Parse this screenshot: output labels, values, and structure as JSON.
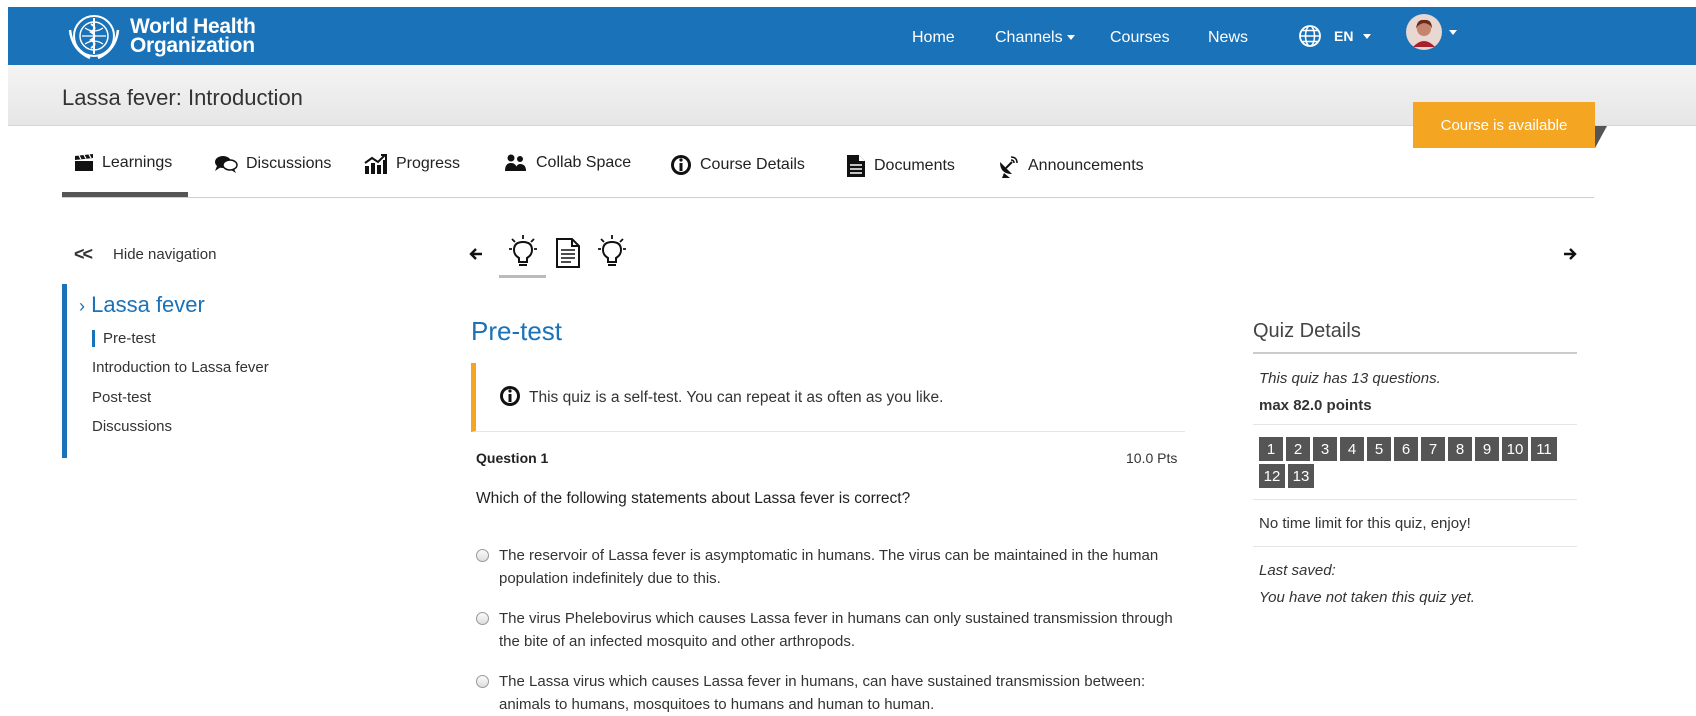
{
  "header": {
    "logo": {
      "line1": "World Health",
      "line2": "Organization"
    },
    "nav": [
      {
        "label": "Home"
      },
      {
        "label": "Channels"
      },
      {
        "label": "Courses"
      },
      {
        "label": "News"
      }
    ],
    "language": "EN"
  },
  "course": {
    "title": "Lassa fever: Introduction",
    "status_badge": "Course is available"
  },
  "tabs": [
    {
      "label": "Learnings"
    },
    {
      "label": "Discussions"
    },
    {
      "label": "Progress"
    },
    {
      "label": "Collab Space"
    },
    {
      "label": "Course Details"
    },
    {
      "label": "Documents"
    },
    {
      "label": "Announcements"
    }
  ],
  "sidebar": {
    "hide_label": "Hide navigation",
    "section_title": "Lassa fever",
    "items": [
      {
        "label": "Pre-test"
      },
      {
        "label": "Introduction to Lassa fever"
      },
      {
        "label": "Post-test"
      },
      {
        "label": "Discussions"
      }
    ]
  },
  "main": {
    "title": "Pre-test",
    "notice": "This quiz is a self-test. You can repeat it as often as you like.",
    "question": {
      "label": "Question 1",
      "points": "10.0 Pts",
      "text": "Which of the following statements about Lassa fever is correct?",
      "answers": [
        "The reservoir of Lassa fever is asymptomatic in humans. The virus can be maintained in the human population indefinitely due to this.",
        "The virus Phelebovirus which causes Lassa fever in humans can only sustained transmission through the bite of an infected mosquito and other arthropods.",
        "The Lassa virus which causes Lassa fever in humans, can have sustained transmission between: animals to humans, mosquitoes to humans and human to human."
      ]
    }
  },
  "quiz_details": {
    "title": "Quiz Details",
    "questions_count": "This quiz has 13 questions.",
    "max_points": "max 82.0 points",
    "question_numbers": [
      "1",
      "2",
      "3",
      "4",
      "5",
      "6",
      "7",
      "8",
      "9",
      "10",
      "11",
      "12",
      "13"
    ],
    "time_limit": "No time limit for this quiz, enjoy!",
    "last_saved_label": "Last saved:",
    "last_saved_value": "You have not taken this quiz yet."
  },
  "colors": {
    "brand_blue": "#1a72b8",
    "accent_orange": "#f4a623",
    "number_box": "#555555"
  }
}
